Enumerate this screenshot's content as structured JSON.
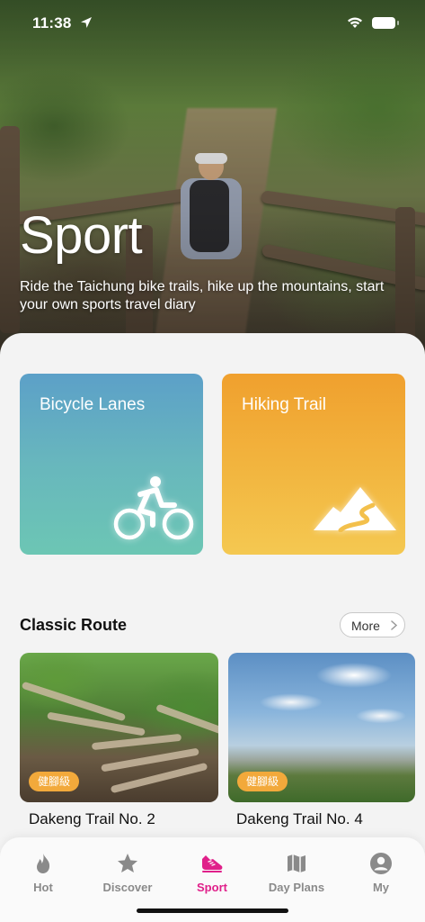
{
  "status_bar": {
    "time": "11:38"
  },
  "hero": {
    "title": "Sport",
    "subtitle": "Ride the Taichung bike trails, hike up the mountains, start your own sports travel diary"
  },
  "categories": [
    {
      "label": "Bicycle Lanes",
      "icon": "bicycle-icon",
      "colors": [
        "#5ca0c8",
        "#6cc6b4"
      ]
    },
    {
      "label": "Hiking Trail",
      "icon": "mountain-trail-icon",
      "colors": [
        "#f0a02e",
        "#f4c851"
      ]
    }
  ],
  "classic_route": {
    "title": "Classic Route",
    "more_label": "More",
    "routes": [
      {
        "name": "Dakeng Trail No. 2",
        "badge": "健腳級"
      },
      {
        "name": "Dakeng Trail No. 4",
        "badge": "健腳級"
      }
    ]
  },
  "tab_bar": {
    "active_color": "#e0208a",
    "tabs": [
      {
        "label": "Hot",
        "icon": "flame-icon"
      },
      {
        "label": "Discover",
        "icon": "star-icon"
      },
      {
        "label": "Sport",
        "icon": "sneaker-icon",
        "active": true
      },
      {
        "label": "Day Plans",
        "icon": "map-icon"
      },
      {
        "label": "My",
        "icon": "profile-icon"
      }
    ]
  }
}
